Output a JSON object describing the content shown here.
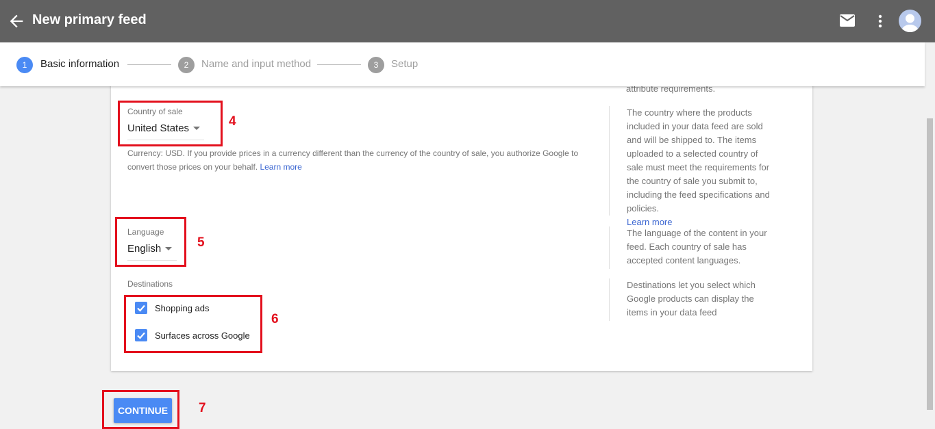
{
  "header": {
    "title": "New primary feed",
    "icons": {
      "back": "back-arrow-icon",
      "mail": "mail-icon",
      "more": "more-vert-icon",
      "avatar": "avatar-icon"
    }
  },
  "stepper": {
    "steps": [
      {
        "number": "1",
        "label": "Basic information",
        "active": true
      },
      {
        "number": "2",
        "label": "Name and input method",
        "active": false
      },
      {
        "number": "3",
        "label": "Setup",
        "active": false
      }
    ]
  },
  "card": {
    "top_clipped_text": "attribute requirements.",
    "country": {
      "label": "Country of sale",
      "value": "United States",
      "hint": "Currency: USD. If you provide prices in a currency different than the currency of the country of sale, you authorize Google to convert those prices on your behalf.",
      "hint_link": "Learn more",
      "helper": "The country where the products included in your data feed are sold and will be shipped to. The items uploaded to a selected country of sale must meet the requirements for the country of sale you submit to, including the feed specifications and policies.",
      "helper_link": "Learn more"
    },
    "language": {
      "label": "Language",
      "value": "English",
      "helper": "The language of the content in your feed. Each country of sale has accepted content languages."
    },
    "destinations": {
      "label": "Destinations",
      "items": [
        {
          "label": "Shopping ads",
          "checked": true
        },
        {
          "label": "Surfaces across Google",
          "checked": true
        }
      ],
      "helper": "Destinations let you select which Google products can display the items in your data feed"
    }
  },
  "continue_label": "CONTINUE",
  "annotations": [
    "4",
    "5",
    "6",
    "7"
  ],
  "colors": {
    "header_bg": "#616161",
    "accent_blue": "#4a8af4",
    "annotation_red": "#e3101d",
    "link": "#3b66d1"
  }
}
